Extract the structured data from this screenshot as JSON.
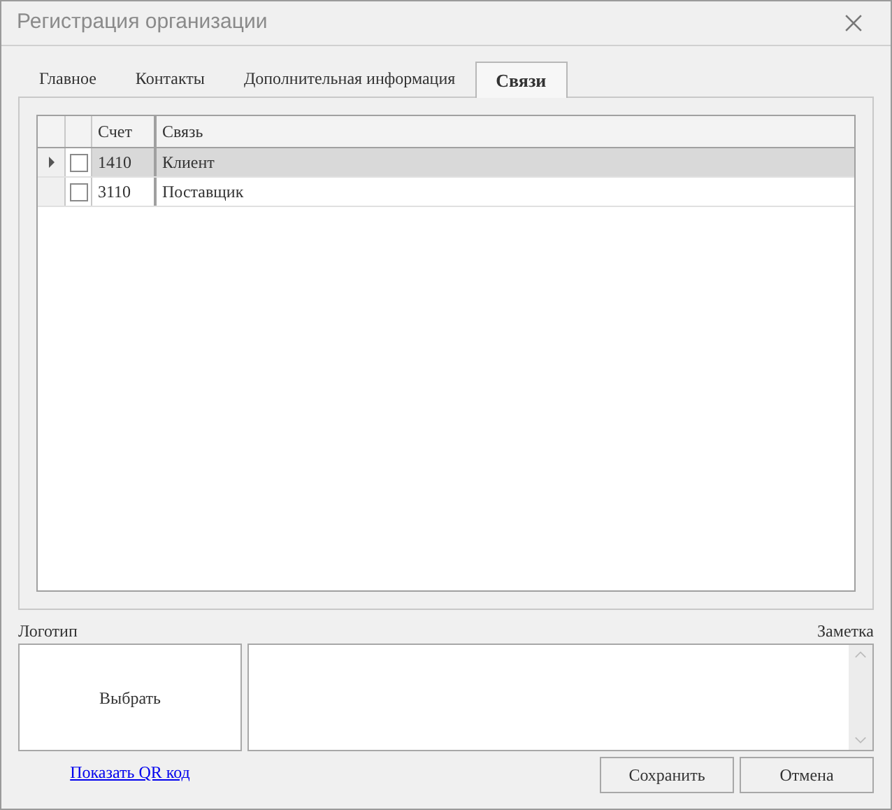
{
  "window": {
    "title": "Регистрация организации"
  },
  "tabs": [
    {
      "label": "Главное",
      "selected": false
    },
    {
      "label": "Контакты",
      "selected": false
    },
    {
      "label": "Дополнительная информация",
      "selected": false
    },
    {
      "label": "Связи",
      "selected": true
    }
  ],
  "table": {
    "columns": [
      "Счет",
      "Связь"
    ],
    "rows": [
      {
        "cells": [
          "1410",
          "Клиент"
        ],
        "selected": true,
        "checked": false
      },
      {
        "cells": [
          "3110",
          "Поставщик"
        ],
        "selected": false,
        "checked": false
      }
    ]
  },
  "logo": {
    "label": "Логотип",
    "button": "Выбрать",
    "link": "Показать QR код"
  },
  "note": {
    "label": "Заметка"
  },
  "buttons": [
    "Сохранить",
    "Отмена"
  ]
}
